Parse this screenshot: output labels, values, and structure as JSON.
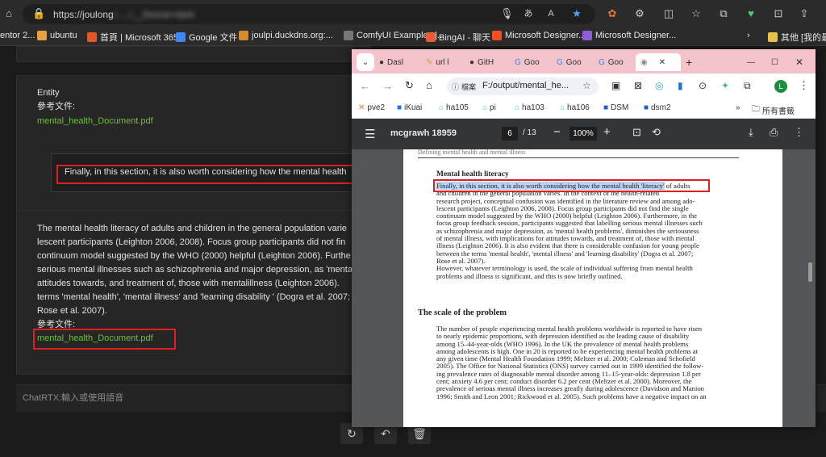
{
  "edge": {
    "url": "https://joulong",
    "url_tail": "/...../__theme=dark",
    "bookmarks": [
      {
        "label": "entor 2...",
        "color": "#888888"
      },
      {
        "label": "ubuntu",
        "color": "#e8a33d"
      },
      {
        "label": "首頁 | Microsoft 365",
        "color": "#e3572a"
      },
      {
        "label": "Google 文件",
        "color": "#4285f4"
      },
      {
        "label": "joulpi.duckdns.org:...",
        "color": "#d88a2a"
      },
      {
        "label": "ComfyUI Examples |...",
        "color": "#cccccc"
      },
      {
        "label": "BingAI - 聊天",
        "color": "#e85d3a"
      },
      {
        "label": "Microsoft Designer...",
        "color": "#f25022"
      },
      {
        "label": "Microsoft Designer...",
        "color": "#8e5cd8"
      }
    ],
    "bookmark_folder": "其他 [我的最愛]"
  },
  "chat": {
    "entity_label": "Entity",
    "ref_label": "參考文件:",
    "ref_file": "mental_health_Document.pdf",
    "user_message": "Finally, in this section, it is also worth considering how the mental health",
    "response_lines": [
      "The mental health literacy of adults and children in the general population varie",
      "lescent participants (Leighton 2006, 2008). Focus group participants did not fin",
      "continuum model suggested by the WHO (2000) helpful (Leighton 2006). Furthe",
      "serious mental illnesses such as schizophrenia and major depression, as 'mental",
      "attitudes towards, and treatment of, those with mentalillness (Leighton 2006).",
      "terms 'mental health', 'mental illness' and 'learning disability ' (Dogra et al. 2007;",
      "Rose et al. 2007)."
    ],
    "response_ref_label": "參考文件:",
    "response_ref_file": "mental_health_Document.pdf",
    "input_placeholder": "ChatRTX:輸入或使用語音"
  },
  "chrome": {
    "tabs": [
      "Dasl",
      "url l",
      "GitH",
      "Goo",
      "Goo",
      "Goo",
      ""
    ],
    "url": "F:/output/mental_he...",
    "url_chip": "檔案",
    "profile_letter": "L",
    "bookmarks": [
      "pve2",
      "iKuai",
      "ha105",
      "pi",
      "ha103",
      "ha106",
      "DSM",
      "dsm2"
    ],
    "bookmarks_folder": "所有書籤",
    "pdf": {
      "title": "mcgrawh 18959",
      "page_current": "6",
      "page_total": "/ 13",
      "zoom": "100%",
      "running_header": "Defining mental health and mental illness",
      "h1": "Mental health literacy",
      "hl_line": "Finally, in this section, it is also worth considering how the mental health 'literacy'",
      "hl_tail": "of adults",
      "p1": [
        "and children in the general population varies. In the context of the health-related",
        "research project, conceptual confusion was identified in the literature review and among ado-",
        "lescent participants (Leighton 2006, 2008). Focus group participants did not find the single",
        "continuum model suggested by the WHO (2000) helpful (Leighton 2006). Furthermore, in the",
        "focus group feedback session, participants suggested that labelling serious mental illnesses such",
        "as schizophrenia and major depression, as 'mental health problems', diminishes the seriousness",
        "of mental illness, with implications for attitudes towards, and treatment of, those with mental",
        "illness (Leighton 2006). It is also evident that there is considerable confusion for young people",
        "between the terms 'mental health', 'mental illness' and 'learning disability' (Dogra et al. 2007;",
        "Rose et al. 2007)."
      ],
      "p2": [
        "     However, whatever terminology is used, the scale of individual suffering from mental health",
        "problems and illness is significant, and this is now briefly outlined."
      ],
      "h2": "The scale of the problem",
      "p3": [
        "The number of people experiencing mental health problems worldwide is reported to have risen",
        "to nearly epidemic proportions, with depression identified as the leading cause of disability",
        "among 15–44-year-olds (WHO 1996). In the UK the prevalence of mental health problems",
        "among adolescents is high. One in 20 is reported to be experiencing mental health problems at",
        "any given time (Mental Health Foundation 1999; Meltzer et al. 2000; Coleman and Schofield",
        "2005). The Office for National Statistics (ONS) survey carried out in 1999 identified the follow-",
        "ing prevalence rates of diagnosable mental disorder among 11–15-year-olds: depression 1.8 per",
        "cent; anxiety 4.6 per cent; conduct disorder 6.2 per cent (Meltzer et al. 2000). Moreover, the",
        "prevalence of serious mental illness increases greatly during adolescence (Davidson and Manion",
        "1996; Smith and Leon 2001; Rickwood et al. 2005). Such problems have a negative impact on an"
      ]
    }
  },
  "colors": {
    "link_green": "#6fbf3a",
    "annotation_red": "#e02020",
    "chrome_tabbar": "#f4c2cb",
    "pdf_toolbar": "#323639",
    "pdf_highlight": "#b8d3f5"
  }
}
